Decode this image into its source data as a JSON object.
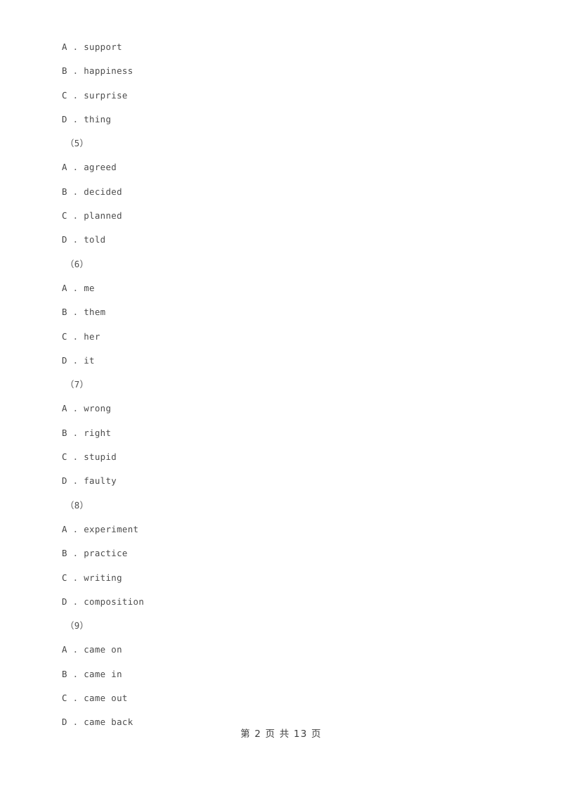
{
  "document": {
    "page_number_footer": "第 2 页 共 13 页"
  },
  "questions": [
    {
      "number": "",
      "options": [
        {
          "letter": "A",
          "separator": " . ",
          "text": "support"
        },
        {
          "letter": "B",
          "separator": " . ",
          "text": "happiness"
        },
        {
          "letter": "C",
          "separator": " . ",
          "text": "surprise"
        },
        {
          "letter": "D",
          "separator": " . ",
          "text": "thing"
        }
      ]
    },
    {
      "number": "（5）",
      "options": [
        {
          "letter": "A",
          "separator": " . ",
          "text": "agreed"
        },
        {
          "letter": "B",
          "separator": " . ",
          "text": "decided"
        },
        {
          "letter": "C",
          "separator": " . ",
          "text": "planned"
        },
        {
          "letter": "D",
          "separator": " . ",
          "text": "told"
        }
      ]
    },
    {
      "number": "（6）",
      "options": [
        {
          "letter": "A",
          "separator": " . ",
          "text": "me"
        },
        {
          "letter": "B",
          "separator": " . ",
          "text": "them"
        },
        {
          "letter": "C",
          "separator": " . ",
          "text": "her"
        },
        {
          "letter": "D",
          "separator": " . ",
          "text": "it"
        }
      ]
    },
    {
      "number": "（7）",
      "options": [
        {
          "letter": "A",
          "separator": " . ",
          "text": "wrong"
        },
        {
          "letter": "B",
          "separator": " . ",
          "text": "right"
        },
        {
          "letter": "C",
          "separator": " . ",
          "text": "stupid"
        },
        {
          "letter": "D",
          "separator": " . ",
          "text": "faulty"
        }
      ]
    },
    {
      "number": "（8）",
      "options": [
        {
          "letter": "A",
          "separator": " . ",
          "text": "experiment"
        },
        {
          "letter": "B",
          "separator": " . ",
          "text": "practice"
        },
        {
          "letter": "C",
          "separator": " . ",
          "text": "writing"
        },
        {
          "letter": "D",
          "separator": " . ",
          "text": "composition"
        }
      ]
    },
    {
      "number": "（9）",
      "options": [
        {
          "letter": "A",
          "separator": " . ",
          "text": "came on"
        },
        {
          "letter": "B",
          "separator": " . ",
          "text": "came in"
        },
        {
          "letter": "C",
          "separator": " . ",
          "text": "came out"
        },
        {
          "letter": "D",
          "separator": " . ",
          "text": "came back"
        }
      ]
    }
  ]
}
